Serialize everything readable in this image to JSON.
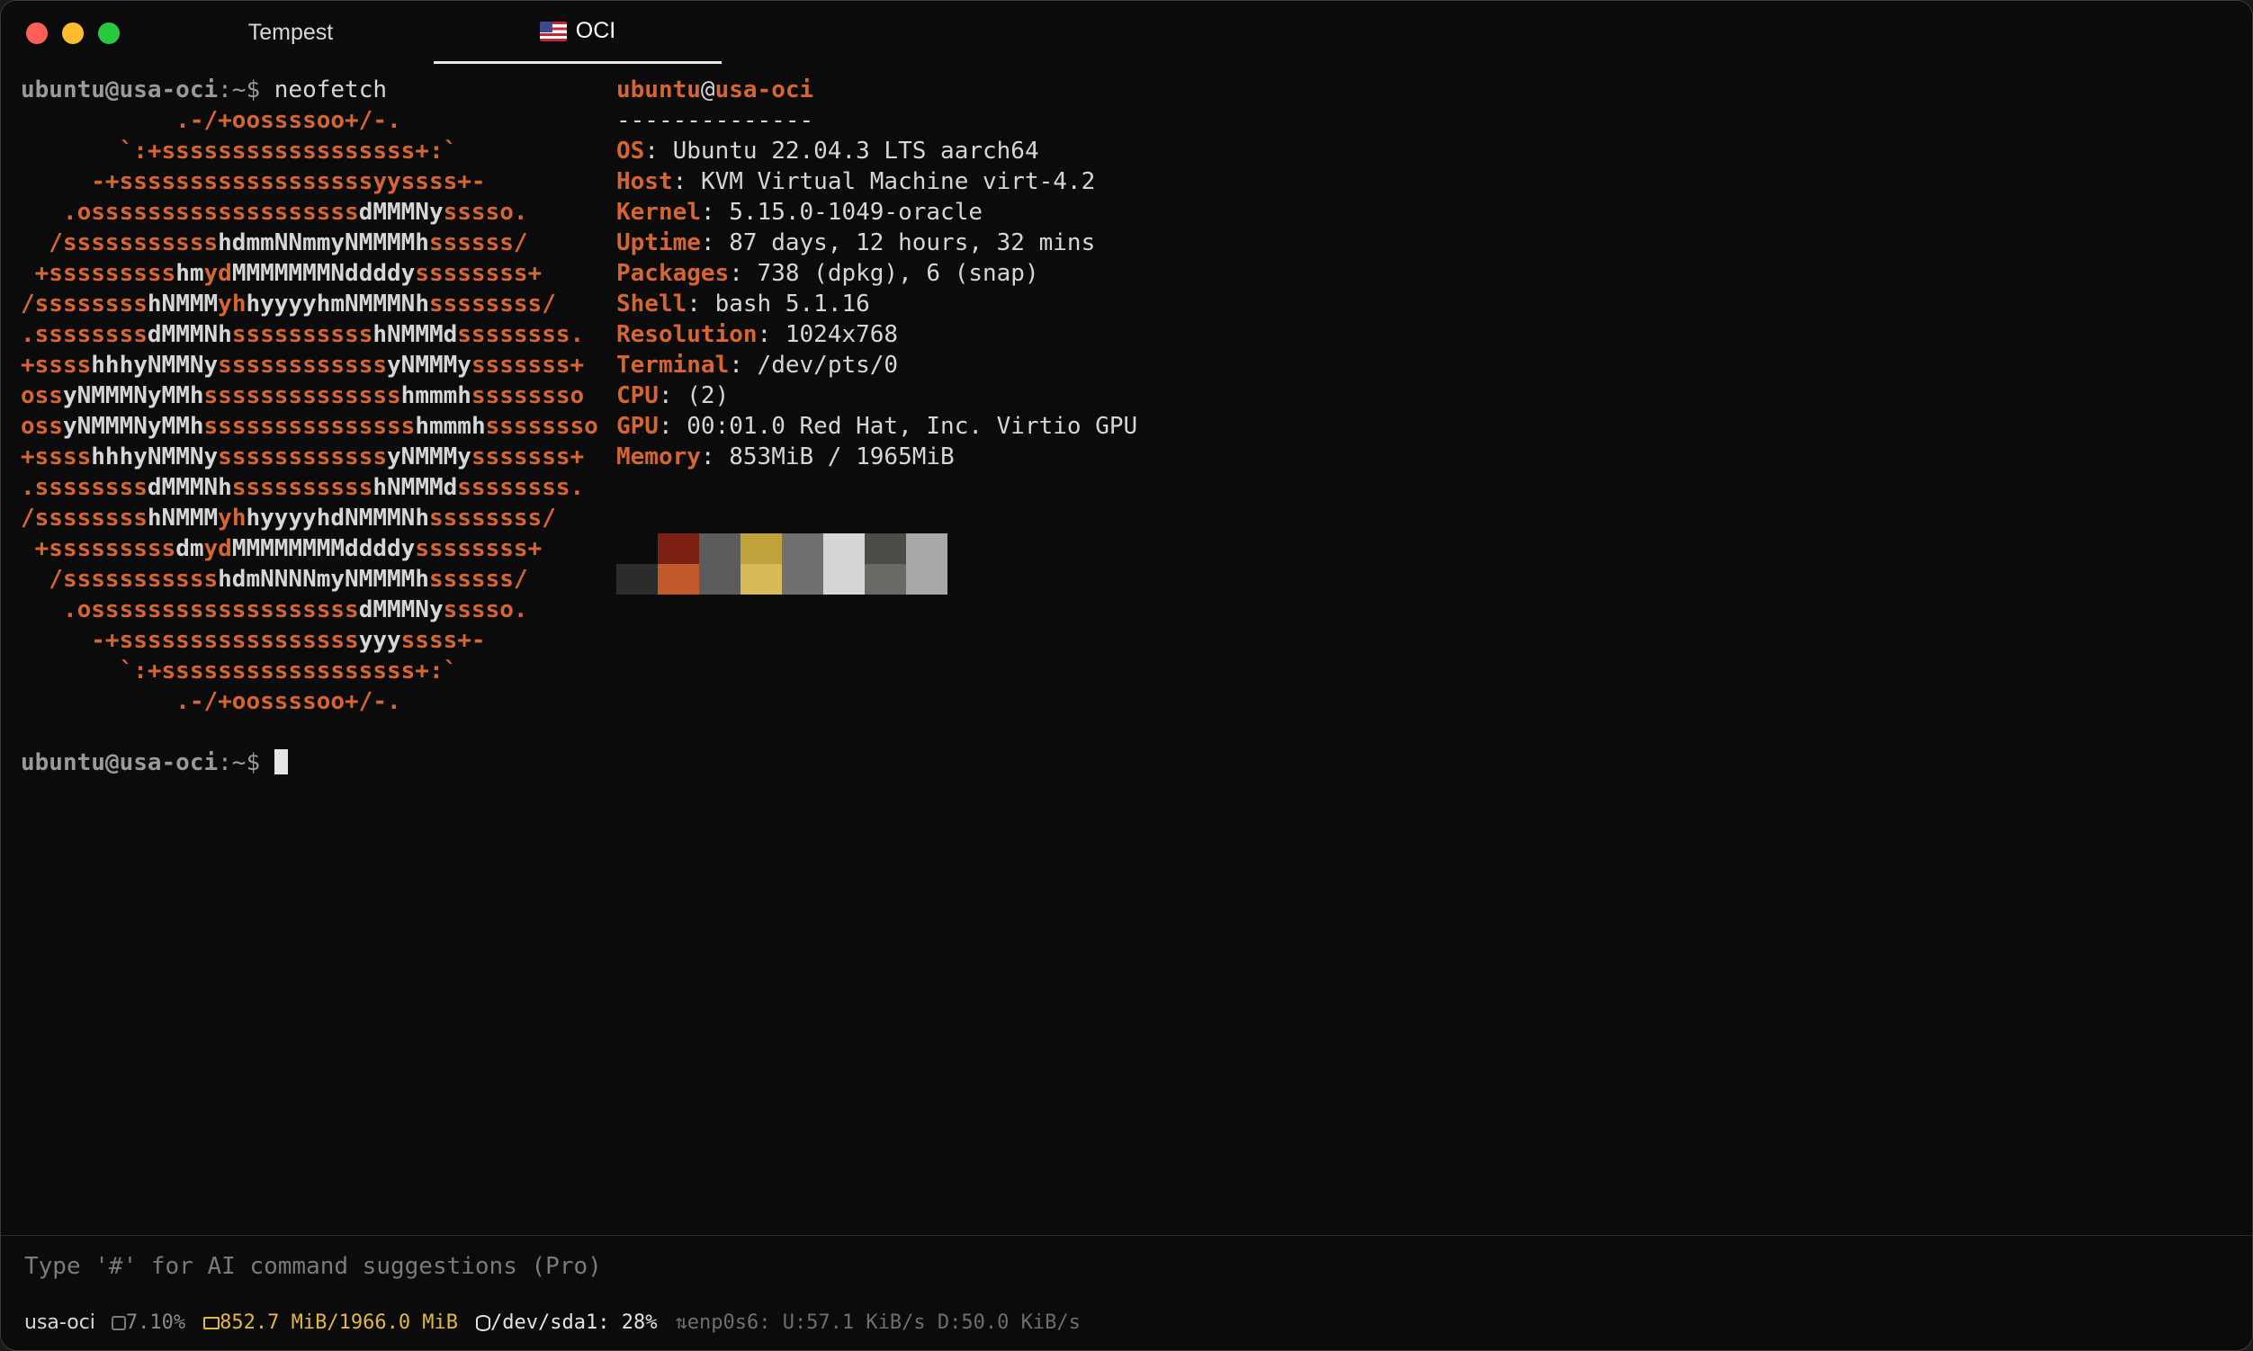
{
  "tabs": [
    {
      "label": "Tempest",
      "active": false
    },
    {
      "label": "OCI",
      "active": true,
      "icon": "us-flag-icon"
    }
  ],
  "prompt": {
    "user_host": "ubuntu@usa-oci",
    "path": ":~$ ",
    "command": "neofetch"
  },
  "logo_lines": [
    [
      [
        "o",
        "           .-/+oossssoo+/-."
      ]
    ],
    [
      [
        "o",
        "       `:+ssssssssssssssssss+:`"
      ]
    ],
    [
      [
        "o",
        "     -+ssssssssssssssssssyyssss+-"
      ]
    ],
    [
      [
        "o",
        "   .osssssssssssssssssss"
      ],
      [
        "w",
        "dMMMNy"
      ],
      [
        "o",
        "sssso."
      ]
    ],
    [
      [
        "o",
        "  /sssssssssss"
      ],
      [
        "w",
        "hdmmNNmmyNMMMMh"
      ],
      [
        "o",
        "ssssss/"
      ]
    ],
    [
      [
        "o",
        " +sssssssss"
      ],
      [
        "w",
        "hm"
      ],
      [
        "o",
        "yd"
      ],
      [
        "w",
        "MMMMMMMNddddy"
      ],
      [
        "o",
        "ssssssss+"
      ]
    ],
    [
      [
        "o",
        "/ssssssss"
      ],
      [
        "w",
        "hNMMM"
      ],
      [
        "o",
        "yh"
      ],
      [
        "w",
        "hyyyyhmNMMMNh"
      ],
      [
        "o",
        "ssssssss/"
      ]
    ],
    [
      [
        "o",
        ".ssssssss"
      ],
      [
        "w",
        "dMMMNh"
      ],
      [
        "o",
        "ssssssssss"
      ],
      [
        "w",
        "hNMMMd"
      ],
      [
        "o",
        "ssssssss."
      ]
    ],
    [
      [
        "o",
        "+ssss"
      ],
      [
        "w",
        "hhhyNMMNy"
      ],
      [
        "o",
        "ssssssssssss"
      ],
      [
        "w",
        "yNMMMy"
      ],
      [
        "o",
        "sssssss+"
      ]
    ],
    [
      [
        "o",
        "oss"
      ],
      [
        "w",
        "yNMMMNyMMh"
      ],
      [
        "o",
        "ssssssssssssss"
      ],
      [
        "w",
        "hmmmh"
      ],
      [
        "o",
        "ssssssso"
      ]
    ],
    [
      [
        "o",
        "oss"
      ],
      [
        "w",
        "yNMMMNyMMh"
      ],
      [
        "o",
        "sssssssssssssss"
      ],
      [
        "w",
        "hmmmh"
      ],
      [
        "o",
        "ssssssso"
      ]
    ],
    [
      [
        "o",
        "+ssss"
      ],
      [
        "w",
        "hhhyNMMNy"
      ],
      [
        "o",
        "ssssssssssss"
      ],
      [
        "w",
        "yNMMMy"
      ],
      [
        "o",
        "sssssss+"
      ]
    ],
    [
      [
        "o",
        ".ssssssss"
      ],
      [
        "w",
        "dMMMNh"
      ],
      [
        "o",
        "ssssssssss"
      ],
      [
        "w",
        "hNMMMd"
      ],
      [
        "o",
        "ssssssss."
      ]
    ],
    [
      [
        "o",
        "/ssssssss"
      ],
      [
        "w",
        "hNMMM"
      ],
      [
        "o",
        "yh"
      ],
      [
        "w",
        "hyyyyhdNMMMNh"
      ],
      [
        "o",
        "ssssssss/"
      ]
    ],
    [
      [
        "o",
        " +sssssssss"
      ],
      [
        "w",
        "dm"
      ],
      [
        "o",
        "yd"
      ],
      [
        "w",
        "MMMMMMMMddddy"
      ],
      [
        "o",
        "ssssssss+"
      ]
    ],
    [
      [
        "o",
        "  /sssssssssss"
      ],
      [
        "w",
        "hdmNNNNmyNMMMMh"
      ],
      [
        "o",
        "ssssss/"
      ]
    ],
    [
      [
        "o",
        "   .osssssssssssssssssss"
      ],
      [
        "w",
        "dMMMNy"
      ],
      [
        "o",
        "sssso."
      ]
    ],
    [
      [
        "o",
        "     -+sssssssssssssssss"
      ],
      [
        "w",
        "yyy"
      ],
      [
        "o",
        "ssss+-"
      ]
    ],
    [
      [
        "o",
        "       `:+ssssssssssssssssss+:`"
      ]
    ],
    [
      [
        "o",
        "           .-/+oossssoo+/-."
      ]
    ]
  ],
  "info": {
    "user": "ubuntu",
    "at": "@",
    "host": "usa-oci",
    "separator": "--------------",
    "fields": [
      {
        "key": "OS",
        "value": "Ubuntu 22.04.3 LTS aarch64"
      },
      {
        "key": "Host",
        "value": "KVM Virtual Machine virt-4.2"
      },
      {
        "key": "Kernel",
        "value": "5.15.0-1049-oracle"
      },
      {
        "key": "Uptime",
        "value": "87 days, 12 hours, 32 mins"
      },
      {
        "key": "Packages",
        "value": "738 (dpkg), 6 (snap)"
      },
      {
        "key": "Shell",
        "value": "bash 5.1.16"
      },
      {
        "key": "Resolution",
        "value": "1024x768"
      },
      {
        "key": "Terminal",
        "value": "/dev/pts/0"
      },
      {
        "key": "CPU",
        "value": "(2)"
      },
      {
        "key": "GPU",
        "value": "00:01.0 Red Hat, Inc. Virtio GPU"
      },
      {
        "key": "Memory",
        "value": "853MiB / 1965MiB"
      }
    ]
  },
  "palette": {
    "top": [
      "#0b0b0b",
      "#7a1f12",
      "#5c5c5c",
      "#c0a23a",
      "#707070",
      "#d6d6d4",
      "#4a4c48",
      "#a8a8a6"
    ],
    "bottom": [
      "#2c2c2c",
      "#c2592a",
      "#5c5c5c",
      "#d8bb58",
      "#707070",
      "#d6d6d4",
      "#686a66",
      "#a8a8a6"
    ]
  },
  "input_placeholder": "Type '#' for AI command suggestions (Pro)",
  "status_bar": {
    "host": "usa-oci",
    "cpu": "7.10%",
    "memory": "852.7 MiB/1966.0 MiB",
    "disk": "/dev/sda1: 28%",
    "network": "enp0s6: U:57.1 KiB/s D:50.0 KiB/s"
  }
}
